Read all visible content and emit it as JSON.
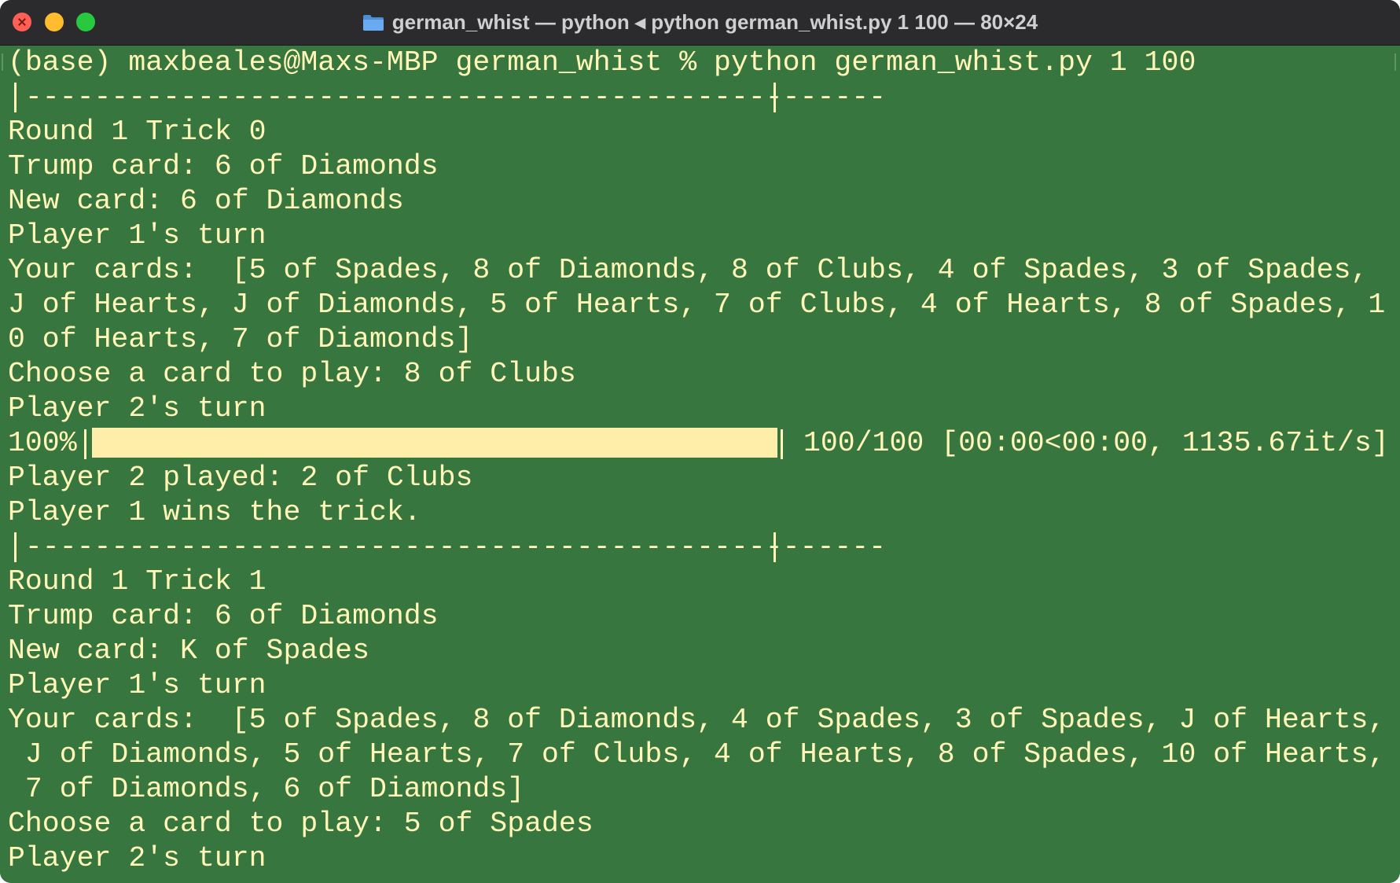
{
  "window": {
    "title": "german_whist — python ◂ python german_whist.py 1 100 — 80×24",
    "icons": [
      "close-button",
      "minimize-button",
      "zoom-button",
      "folder-icon"
    ],
    "colors": {
      "background": "#37773f",
      "text": "#fff6b8",
      "titlebar": "#2b2b2d"
    }
  },
  "terminal": {
    "lines_before_progress": [
      "(base) maxbeales@Maxs-MBP german_whist % python german_whist.py 1 100",
      "|--------------------------------------------------|",
      "Round 1 Trick 0",
      "Trump card: 6 of Diamonds",
      "New card: 6 of Diamonds",
      "Player 1's turn",
      "Your cards:  [5 of Spades, 8 of Diamonds, 8 of Clubs, 4 of Spades, 3 of Spades,",
      "J of Hearts, J of Diamonds, 5 of Hearts, 7 of Clubs, 4 of Hearts, 8 of Spades, 1",
      "0 of Hearts, 7 of Diamonds]",
      "Choose a card to play: 8 of Clubs",
      "Player 2's turn"
    ],
    "progress": {
      "percent_label": "100%",
      "fraction": 1.0,
      "stats": "100/100 [00:00<00:00, 1135.67it/s]"
    },
    "lines_after_progress": [
      "Player 2 played: 2 of Clubs",
      "Player 1 wins the trick.",
      "|--------------------------------------------------|",
      "Round 1 Trick 1",
      "Trump card: 6 of Diamonds",
      "New card: K of Spades",
      "Player 1's turn",
      "Your cards:  [5 of Spades, 8 of Diamonds, 4 of Spades, 3 of Spades, J of Hearts,",
      " J of Diamonds, 5 of Hearts, 7 of Clubs, 4 of Hearts, 8 of Spades, 10 of Hearts,",
      " 7 of Diamonds, 6 of Diamonds]",
      "Choose a card to play: 5 of Spades",
      "Player 2's turn"
    ]
  }
}
